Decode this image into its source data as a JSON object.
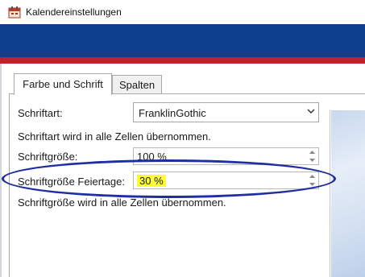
{
  "window": {
    "title": "Kalendereinstellungen"
  },
  "tabs": [
    {
      "label": "Farbe und Schrift"
    },
    {
      "label": "Spalten"
    }
  ],
  "font": {
    "label": "Schriftart:",
    "value": "FranklinGothic",
    "note": "Schriftart wird in alle Zellen übernommen."
  },
  "font_size": {
    "label": "Schriftgröße:",
    "value": "100 %"
  },
  "holiday_font_size": {
    "label": "Schriftgröße Feiertage:",
    "value": "30 %",
    "note": "Schriftgröße wird in alle Zellen übernommen."
  },
  "colors": {
    "banner_blue": "#0d3f8e",
    "banner_red": "#c41f2e",
    "highlight": "#ffff33",
    "annotation": "#1f2ea0"
  }
}
